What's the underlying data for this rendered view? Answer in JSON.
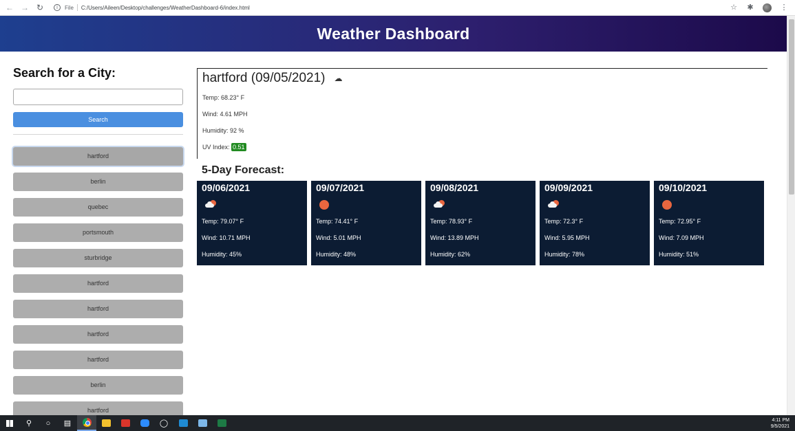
{
  "browser": {
    "scheme": "File",
    "url": "C:/Users/Aileen/Desktop/challenges/WeatherDashboard-6/index.html"
  },
  "header": {
    "title": "Weather Dashboard"
  },
  "sidebar": {
    "heading": "Search for a City:",
    "search_placeholder": "",
    "search_button": "Search",
    "history": [
      "hartford",
      "berlin",
      "quebec",
      "portsmouth",
      "sturbridge",
      "hartford",
      "hartford",
      "hartford",
      "hartford",
      "berlin",
      "hartford"
    ]
  },
  "current": {
    "title": "hartford (09/05/2021)",
    "icon": "cloud-icon",
    "temp": "Temp: 68.23° F",
    "wind": "Wind: 4.61 MPH",
    "humidity": "Humidity: 92 %",
    "uv_label": "UV Index:",
    "uv_value": "0.51",
    "uv_color": "#228b22"
  },
  "forecast": {
    "title": "5-Day Forecast:",
    "days": [
      {
        "date": "09/06/2021",
        "icon": "cloud-sun-icon",
        "temp": "Temp: 79.07° F",
        "wind": "Wind: 10.71 MPH",
        "humidity": "Humidity: 45%"
      },
      {
        "date": "09/07/2021",
        "icon": "sun-icon",
        "temp": "Temp: 74.41° F",
        "wind": "Wind: 5.01 MPH",
        "humidity": "Humidity: 48%"
      },
      {
        "date": "09/08/2021",
        "icon": "cloud-sun-icon",
        "temp": "Temp: 78.93° F",
        "wind": "Wind: 13.89 MPH",
        "humidity": "Humidity: 62%"
      },
      {
        "date": "09/09/2021",
        "icon": "cloud-sun-icon",
        "temp": "Temp: 72.3° F",
        "wind": "Wind: 5.95 MPH",
        "humidity": "Humidity: 78%"
      },
      {
        "date": "09/10/2021",
        "icon": "sun-icon",
        "temp": "Temp: 72.95° F",
        "wind": "Wind: 7.09 MPH",
        "humidity": "Humidity: 51%"
      }
    ]
  },
  "taskbar": {
    "time": "4:11 PM",
    "date": "9/5/2021"
  },
  "colors": {
    "card_bg": "#0c1c33",
    "search_button": "#4a8fe0",
    "history_button": "#adadad",
    "sun": "#e9663f"
  }
}
